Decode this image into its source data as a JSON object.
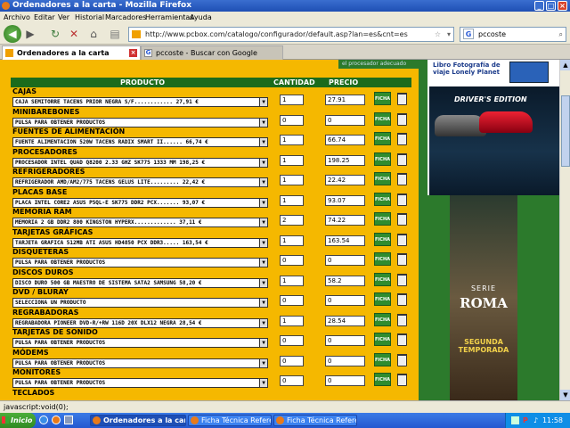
{
  "window": {
    "title": "Ordenadores a la carta - Mozilla Firefox"
  },
  "menu": [
    "Archivo",
    "Editar",
    "Ver",
    "Historial",
    "Marcadores",
    "Herramientas",
    "Ayuda"
  ],
  "nav": {
    "url": "http://www.pcbox.com/catalogo/configurador/default.asp?lan=es&cnt=es",
    "search": "pccoste"
  },
  "tabs": [
    {
      "label": "Ordenadores a la carta",
      "active": true
    },
    {
      "label": "pccoste - Buscar con Google",
      "active": false
    }
  ],
  "table": {
    "headers": {
      "product": "PRODUCTO",
      "qty": "CANTIDAD",
      "price": "PRECIO"
    },
    "ficha_label": "FICHA",
    "rows": [
      {
        "category": "CAJAS",
        "select": "CAJA SEMITORRE TACENS PRIOR NEGRA S/F............ 27,91 €",
        "qty": "1",
        "price": "27.91"
      },
      {
        "category": "MINIBAREBONES",
        "select": "PULSA PARA OBTENER PRODUCTOS",
        "qty": "0",
        "price": "0"
      },
      {
        "category": "FUENTES DE ALIMENTACIÓN",
        "select": "FUENTE ALIMENTACION 520W TACENS RADIX SMART II...... 66,74 €",
        "qty": "1",
        "price": "66.74"
      },
      {
        "category": "PROCESADORES",
        "select": "PROCESADOR INTEL QUAD Q8200 2.33 GHZ SK775 1333 MM 198,25 €",
        "qty": "1",
        "price": "198.25"
      },
      {
        "category": "REFRIGERADORES",
        "select": "REFRIGERADOR AMD/AM2/775 TACENS GELUS LITE......... 22,42 €",
        "qty": "1",
        "price": "22.42"
      },
      {
        "category": "PLACAS BASE",
        "select": "PLACA INTEL CORE2 ASUS P5QL-E SK775 DDR2 PCX....... 93,07 €",
        "qty": "1",
        "price": "93.07"
      },
      {
        "category": "MEMORIA RAM",
        "select": "MEMORIA 2 GB DDR2 800 KINGSTON HYPERX............. 37,11 €",
        "qty": "2",
        "price": "74.22"
      },
      {
        "category": "TARJETAS GRÁFICAS",
        "select": "TARJETA GRAFICA 512MB ATI ASUS HD4850 PCX DDR3..... 163,54 €",
        "qty": "1",
        "price": "163.54"
      },
      {
        "category": "DISQUETERAS",
        "select": "PULSA PARA OBTENER PRODUCTOS",
        "qty": "0",
        "price": "0"
      },
      {
        "category": "DISCOS DUROS",
        "select": "DISCO DURO 500 GB MAESTRO DE SISTEMA SATA2 SAMSUNG 58,20 €",
        "qty": "1",
        "price": "58.2"
      },
      {
        "category": "DVD / BLURAY",
        "select": "SELECCIONA UN PRODUCTO",
        "qty": "0",
        "price": "0"
      },
      {
        "category": "REGRABADORAS",
        "select": "REGRABADORA PIONEER DVD-R/+RW 116D 20X DLX12 NEGRA 28,54 €",
        "qty": "1",
        "price": "28.54"
      },
      {
        "category": "TARJETAS DE SONIDO",
        "select": "PULSA PARA OBTENER PRODUCTOS",
        "qty": "0",
        "price": "0"
      },
      {
        "category": "MÓDEMS",
        "select": "PULSA PARA OBTENER PRODUCTOS",
        "qty": "0",
        "price": "0"
      },
      {
        "category": "MONITORES",
        "select": "PULSA PARA OBTENER PRODUCTOS",
        "qty": "0",
        "price": "0"
      },
      {
        "category": "TECLADOS",
        "select": "",
        "qty": "",
        "price": ""
      }
    ]
  },
  "ads": {
    "top_text": "el procesador adecuado",
    "lonely_planet": "Libro Fotografía de viaje Lonely Planet",
    "drivers_edition": "DRIVER'S EDITION",
    "serie": "SERIE",
    "roma": "ROMA",
    "season": "SEGUNDA TEMPORADA"
  },
  "status": "javascript:void(0);",
  "taskbar": {
    "start": "Inicio",
    "buttons": [
      "Ordenadores a la cart...",
      "Ficha Técnica Referencia...",
      "Ficha Técnica Referencia..."
    ],
    "clock": "11:58"
  }
}
